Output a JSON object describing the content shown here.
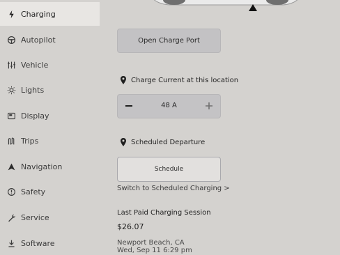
{
  "sidebar": {
    "items": [
      {
        "label": "Charging",
        "icon": "bolt-icon",
        "active": true
      },
      {
        "label": "Autopilot",
        "icon": "steering-wheel-icon"
      },
      {
        "label": "Vehicle",
        "icon": "sliders-icon"
      },
      {
        "label": "Lights",
        "icon": "sun-icon"
      },
      {
        "label": "Display",
        "icon": "display-icon"
      },
      {
        "label": "Trips",
        "icon": "route-icon"
      },
      {
        "label": "Navigation",
        "icon": "navigation-arrow-icon"
      },
      {
        "label": "Safety",
        "icon": "safety-icon"
      },
      {
        "label": "Service",
        "icon": "wrench-icon"
      },
      {
        "label": "Software",
        "icon": "download-icon"
      }
    ]
  },
  "main": {
    "open_charge_port": "Open Charge Port",
    "charge_current_label": "Charge Current at this location",
    "charge_current_value": "48 A",
    "scheduled_departure_label": "Scheduled Departure",
    "schedule_button": "Schedule",
    "switch_link": "Switch to Scheduled Charging >",
    "last_session_heading": "Last Paid Charging Session",
    "last_session_amount": "$26.07",
    "last_session_location": "Newport Beach, CA",
    "last_session_date": "Wed, Sep 11 6:29 pm"
  }
}
